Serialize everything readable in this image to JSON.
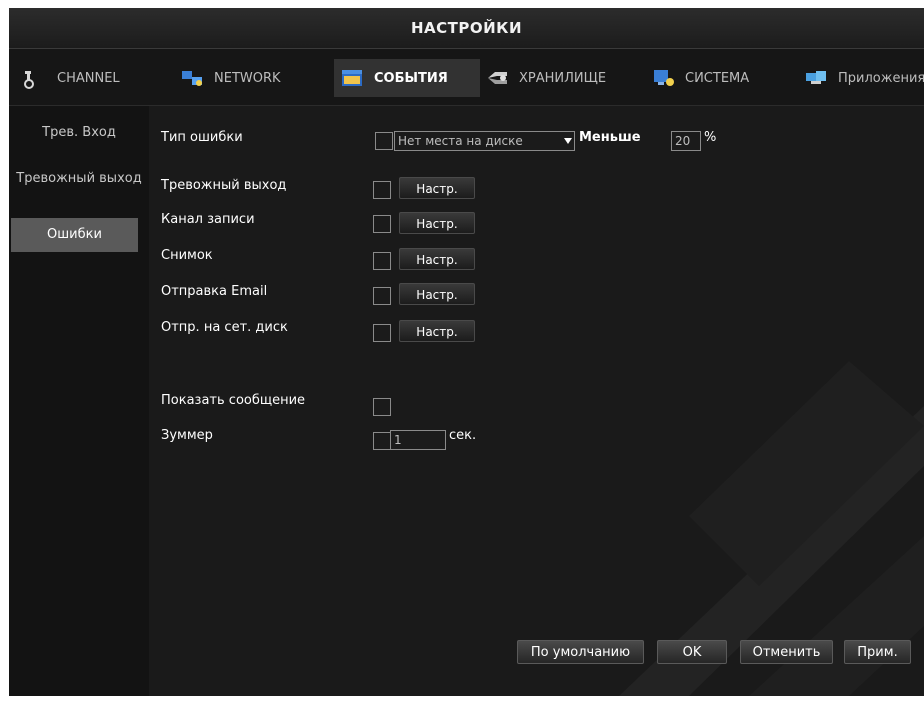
{
  "window": {
    "title": "НАСТРОЙКИ"
  },
  "tabs": [
    {
      "label": "CHANNEL",
      "icon": "camera-icon",
      "active": false
    },
    {
      "label": "NETWORK",
      "icon": "network-icon",
      "active": false
    },
    {
      "label": "СОБЫТИЯ",
      "icon": "events-icon",
      "active": true
    },
    {
      "label": "ХРАНИЛИЩЕ",
      "icon": "storage-icon",
      "active": false
    },
    {
      "label": "СИСТЕМА",
      "icon": "system-icon",
      "active": false
    },
    {
      "label": "Приложения",
      "icon": "apps-icon",
      "active": false
    }
  ],
  "sidebar": {
    "items": [
      {
        "label": "Трев. Вход"
      },
      {
        "label": "Тревожный выход"
      },
      {
        "label": "Ошибки",
        "active": true
      }
    ]
  },
  "error_settings": {
    "error_type_label": "Тип ошибки",
    "error_type_value": "Нет места на диске",
    "less_label": "Меньше",
    "less_value": "20",
    "percent_sign": "%",
    "rows": [
      {
        "label": "Тревожный выход",
        "button": "Настр."
      },
      {
        "label": "Канал записи",
        "button": "Настр."
      },
      {
        "label": "Снимок",
        "button": "Настр."
      },
      {
        "label": "Отправка Email",
        "button": "Настр."
      },
      {
        "label": "Отпр. на сет. диск",
        "button": "Настр."
      }
    ],
    "show_message_label": "Показать сообщение",
    "buzzer_label": "Зуммер",
    "buzzer_value": "1",
    "buzzer_unit": "сек."
  },
  "footer": {
    "default": "По умолчанию",
    "ok": "OK",
    "cancel": "Отменить",
    "apply": "Прим."
  },
  "colors": {
    "background": "#141414",
    "active_tab": "#323232",
    "active_sidebar": "#5a5a5a",
    "text": "#ffffff"
  }
}
